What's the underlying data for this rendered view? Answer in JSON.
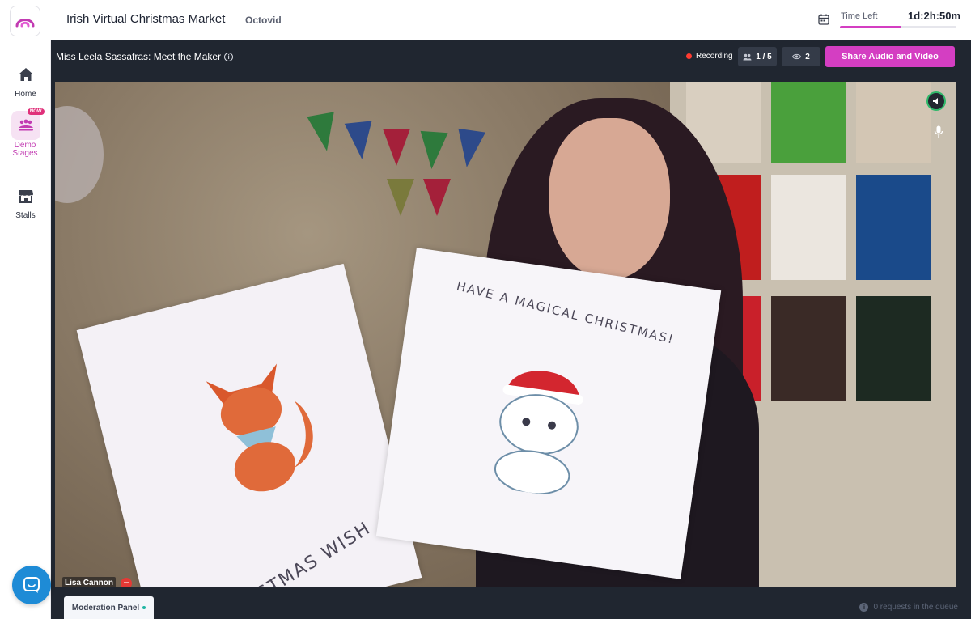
{
  "header": {
    "event_title": "Irish Virtual Christmas Market",
    "organizer": "Octovid",
    "time_left_label": "Time Left",
    "time_left_value": "1d:2h:50m",
    "time_left_progress": 0.53,
    "accent_color": "#d43ec2"
  },
  "sidebar": {
    "items": [
      {
        "label": "Home",
        "icon": "home-icon"
      },
      {
        "label": "Demo Stages",
        "icon": "stage-icon",
        "badge": "NOW",
        "active": true
      },
      {
        "label": "Stalls",
        "icon": "store-icon"
      }
    ],
    "chat_icon": "chat-icon"
  },
  "stage": {
    "title": "Miss Leela Sassafras: Meet the Maker",
    "recording_label": "Recording",
    "speakers_count": "1 / 5",
    "viewers_count": "2",
    "share_button": "Share Audio and Video",
    "participant_name": "Lisa Cannon",
    "card_left_text": "CHRISTMAS WISH",
    "card_right_text": "HAVE A MAGICAL CHRISTMAS!"
  },
  "bottom": {
    "moderation_tab": "Moderation Panel",
    "queue_text": "0 requests in the queue"
  }
}
